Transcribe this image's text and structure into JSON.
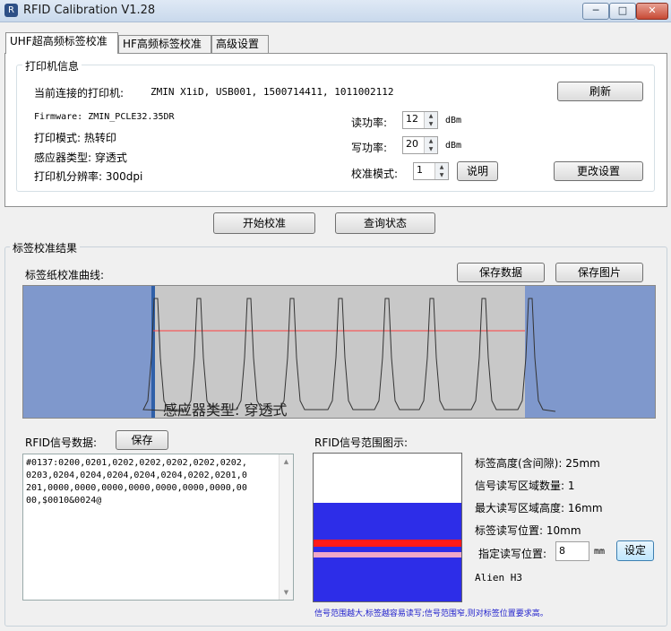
{
  "window": {
    "title": "RFID Calibration V1.28",
    "controls": {
      "minimize": "─",
      "maximize": "□",
      "close": "✕"
    }
  },
  "tabs": [
    {
      "label": "UHF超高频标签校准",
      "active": true
    },
    {
      "label": "HF高频标签校准",
      "active": false
    },
    {
      "label": "高级设置",
      "active": false
    }
  ],
  "printer_info": {
    "legend": "打印机信息",
    "connected_label": "当前连接的打印机:",
    "connected_value": "ZMIN X1iD, USB001, 1500714411, 1011002112",
    "refresh_button": "刷新",
    "firmware": "Firmware: ZMIN_PCLE32.35DR",
    "print_mode": "打印模式: 热转印",
    "sensor_type": "感应器类型: 穿透式",
    "resolution": "打印机分辨率: 300dpi",
    "read_power_label": "读功率:",
    "read_power_value": "12",
    "write_power_label": "写功率:",
    "write_power_value": "20",
    "power_unit": "dBm",
    "calib_mode_label": "校准模式:",
    "calib_mode_value": "1",
    "explain_button": "说明",
    "change_settings_button": "更改设置"
  },
  "actions": {
    "start_calibration": "开始校准",
    "query_status": "查询状态"
  },
  "results": {
    "legend": "标签校准结果",
    "curve_label": "标签纸校准曲线:",
    "save_data_button": "保存数据",
    "save_image_button": "保存图片",
    "chart_overlay_text": "感应器类型: 穿透式",
    "colors": {
      "chart_bg": "#7f98cc",
      "chart_band": "#c8c8c8",
      "threshold_line": "#ff4040",
      "marker": "#3060a8"
    }
  },
  "rfid_data": {
    "label": "RFID信号数据:",
    "save_button": "保存",
    "lines": [
      "#0137:0200,0201,0202,0202,0202,0202,0202,",
      "0203,0204,0204,0204,0204,0204,0202,0201,0",
      "201,0000,0000,0000,0000,0000,0000,0000,00",
      "00,$0010&0024@"
    ]
  },
  "range_diagram": {
    "label": "RFID信号范围图示:",
    "tag_height": "标签高度(含间隙): 25mm",
    "rw_zone_count": "信号读写区域数量: 1",
    "max_rw_zone_height": "最大读写区域高度: 16mm",
    "tag_rw_position": "标签读写位置: 10mm",
    "specify_position_label": "指定读写位置:",
    "specify_position_value": "8",
    "specify_position_unit": "mm",
    "set_button": "设定",
    "chip": "Alien H3",
    "footnote": "信号范围越大,标签越容易读写;信号范围窄,则对标签位置要求高。",
    "colors": {
      "signal": "#2d2de8",
      "position": "#ff1a1a",
      "specified": "#f0a8c8",
      "footnote": "#2222cc"
    }
  }
}
